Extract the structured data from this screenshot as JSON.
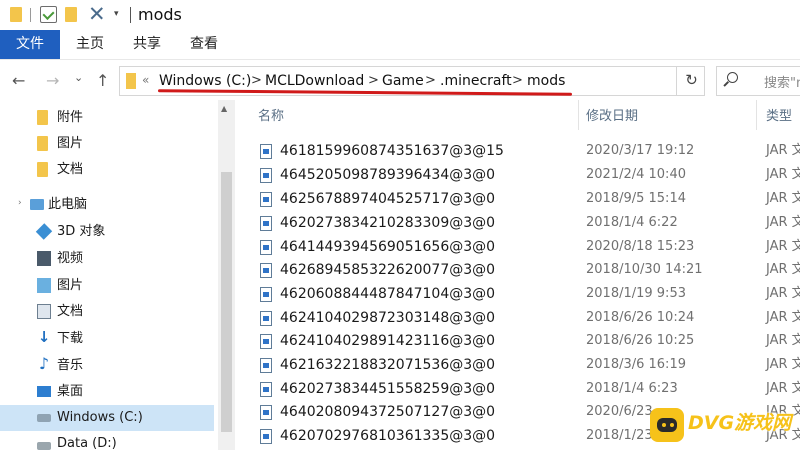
{
  "window": {
    "title": "mods"
  },
  "ribbon": {
    "tabs": [
      "文件",
      "主页",
      "共享",
      "查看"
    ]
  },
  "nav": {
    "back": "←",
    "forward": "→",
    "recent": "⌄",
    "up": "↑"
  },
  "address": {
    "crumbs": [
      "Windows (C:)",
      "MCLDownload",
      "Game",
      ".minecraft",
      "mods"
    ],
    "separator": ">",
    "overflow": "«",
    "refresh": "↻",
    "dropdown": "⌄",
    "underline_color": "#d01a1a"
  },
  "search": {
    "placeholder": "搜索\"mo"
  },
  "sidebar": {
    "items": [
      {
        "label": "附件",
        "icon": "folder-icon"
      },
      {
        "label": "图片",
        "icon": "folder-icon"
      },
      {
        "label": "文档",
        "icon": "folder-icon"
      },
      {
        "label": "此电脑",
        "icon": "computer-icon"
      },
      {
        "label": "3D 对象",
        "icon": "3d-objects-icon"
      },
      {
        "label": "视频",
        "icon": "videos-icon"
      },
      {
        "label": "图片",
        "icon": "pictures-icon"
      },
      {
        "label": "文档",
        "icon": "documents-icon"
      },
      {
        "label": "下载",
        "icon": "download-icon"
      },
      {
        "label": "音乐",
        "icon": "music-icon"
      },
      {
        "label": "桌面",
        "icon": "desktop-icon"
      },
      {
        "label": "Windows (C:)",
        "icon": "drive-icon",
        "selected": true
      },
      {
        "label": "Data (D:)",
        "icon": "drive-icon"
      }
    ]
  },
  "file_list": {
    "columns": [
      "名称",
      "修改日期",
      "类型"
    ],
    "rows": [
      {
        "name": "4618159960874351637@3@15",
        "date": "2020/3/17 19:12",
        "type": "JAR 文"
      },
      {
        "name": "4645205098789396434@3@0",
        "date": "2021/2/4 10:40",
        "type": "JAR 文"
      },
      {
        "name": "4625678897404525717@3@0",
        "date": "2018/9/5 15:14",
        "type": "JAR 文"
      },
      {
        "name": "4620273834210283309@3@0",
        "date": "2018/1/4 6:22",
        "type": "JAR 文"
      },
      {
        "name": "4641449394569051656@3@0",
        "date": "2020/8/18 15:23",
        "type": "JAR 文"
      },
      {
        "name": "4626894585322620077@3@0",
        "date": "2018/10/30 14:21",
        "type": "JAR 文"
      },
      {
        "name": "4620608844487847104@3@0",
        "date": "2018/1/19 9:53",
        "type": "JAR 文"
      },
      {
        "name": "4624104029872303148@3@0",
        "date": "2018/6/26 10:24",
        "type": "JAR 文"
      },
      {
        "name": "4624104029891423116@3@0",
        "date": "2018/6/26 10:25",
        "type": "JAR 文"
      },
      {
        "name": "4621632218832071536@3@0",
        "date": "2018/3/6 16:19",
        "type": "JAR 文"
      },
      {
        "name": "4620273834451558259@3@0",
        "date": "2018/1/4 6:23",
        "type": "JAR 文"
      },
      {
        "name": "4640208094372507127@3@0",
        "date": "2020/6/23",
        "type": "JAR 文"
      },
      {
        "name": "4620702976810361335@3@0",
        "date": "2018/1/23",
        "type": "JAR 文"
      }
    ]
  },
  "watermark": {
    "text": "DVG游戏网"
  }
}
